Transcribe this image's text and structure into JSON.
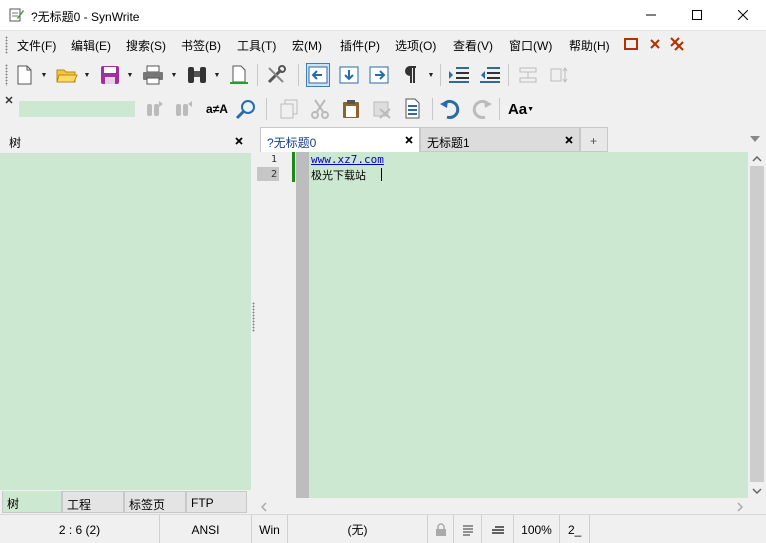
{
  "window": {
    "title": "?无标题0 - SynWrite",
    "app_icon": "notepad-pencil-icon"
  },
  "menu": {
    "items": [
      "文件(F)",
      "编辑(E)",
      "搜索(S)",
      "书签(B)",
      "工具(T)",
      "宏(M)",
      "插件(P)",
      "选项(O)",
      "查看(V)",
      "窗口(W)",
      "帮助(H)"
    ]
  },
  "toolbar": {
    "search_placeholder": "",
    "replace_label": "a≠A",
    "font_label": "Aa"
  },
  "left_panel": {
    "title": "树",
    "tabs": [
      "树",
      "工程",
      "标签页",
      "FTP"
    ],
    "active_tab": 0
  },
  "editor": {
    "tabs": [
      "?无标题0",
      "无标题1"
    ],
    "active_tab": 0,
    "add_tab": "+",
    "lines": [
      {
        "no": "1",
        "text": "www.xz7.com"
      },
      {
        "no": "2",
        "text": "极光下载站"
      }
    ]
  },
  "statusbar": {
    "position": "2 : 6 (2)",
    "encoding": "ANSI",
    "line_ending": "Win",
    "syntax": "(无)",
    "zoom": "100%",
    "extra": "2_"
  },
  "colors": {
    "editor_bg": "#cde8d0",
    "link": "#0000cc",
    "accent": "#3c7fb1"
  }
}
